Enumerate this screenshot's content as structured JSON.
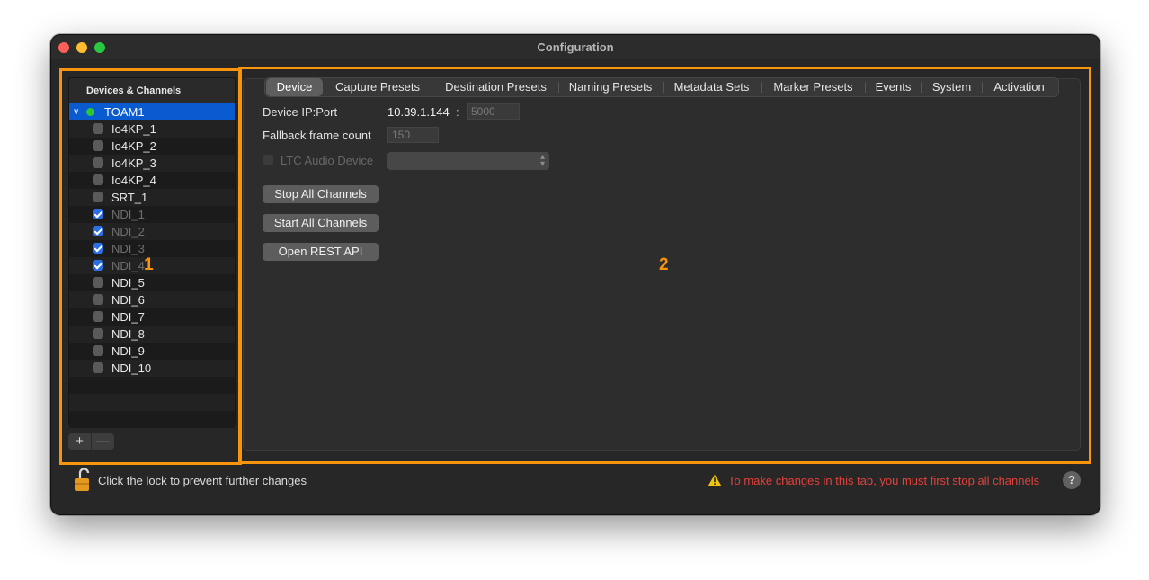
{
  "window": {
    "title": "Configuration"
  },
  "sidebar": {
    "header": "Devices & Channels",
    "root": {
      "label": "TOAM1",
      "status": "online"
    },
    "items": [
      {
        "label": "Io4KP_1",
        "checked": false,
        "dim": false
      },
      {
        "label": "Io4KP_2",
        "checked": false,
        "dim": false
      },
      {
        "label": "Io4KP_3",
        "checked": false,
        "dim": false
      },
      {
        "label": "Io4KP_4",
        "checked": false,
        "dim": false
      },
      {
        "label": "SRT_1",
        "checked": false,
        "dim": false
      },
      {
        "label": "NDI_1",
        "checked": true,
        "dim": true
      },
      {
        "label": "NDI_2",
        "checked": true,
        "dim": true
      },
      {
        "label": "NDI_3",
        "checked": true,
        "dim": true
      },
      {
        "label": "NDI_4",
        "checked": true,
        "dim": true
      },
      {
        "label": "NDI_5",
        "checked": false,
        "dim": false
      },
      {
        "label": "NDI_6",
        "checked": false,
        "dim": false
      },
      {
        "label": "NDI_7",
        "checked": false,
        "dim": false
      },
      {
        "label": "NDI_8",
        "checked": false,
        "dim": false
      },
      {
        "label": "NDI_9",
        "checked": false,
        "dim": false
      },
      {
        "label": "NDI_10",
        "checked": false,
        "dim": false
      }
    ],
    "add_label": "+",
    "remove_label": "—"
  },
  "annotations": {
    "box1": "1",
    "box2": "2"
  },
  "tabs": [
    "Device",
    "Capture Presets",
    "Destination Presets",
    "Naming Presets",
    "Metadata Sets",
    "Marker Presets",
    "Events",
    "System",
    "Activation"
  ],
  "device": {
    "ip_label": "Device IP:Port",
    "ip_value": "10.39.1.144",
    "port_separator": ":",
    "port_value": "5000",
    "fallback_label": "Fallback frame count",
    "fallback_value": "150",
    "ltc_label": "LTC Audio Device",
    "ltc_value": ""
  },
  "buttons": {
    "stop_all": "Stop All Channels",
    "start_all": "Start All Channels",
    "open_rest": "Open REST API"
  },
  "footer": {
    "lock_text": "Click the lock to prevent further changes",
    "warning_text": "To make changes in this tab, you must first stop all channels",
    "help_label": "?"
  },
  "colors": {
    "accent_annotation": "#f9950d",
    "selection": "#0a5bd0",
    "status_online": "#2ec637",
    "warning": "#e4413b"
  }
}
